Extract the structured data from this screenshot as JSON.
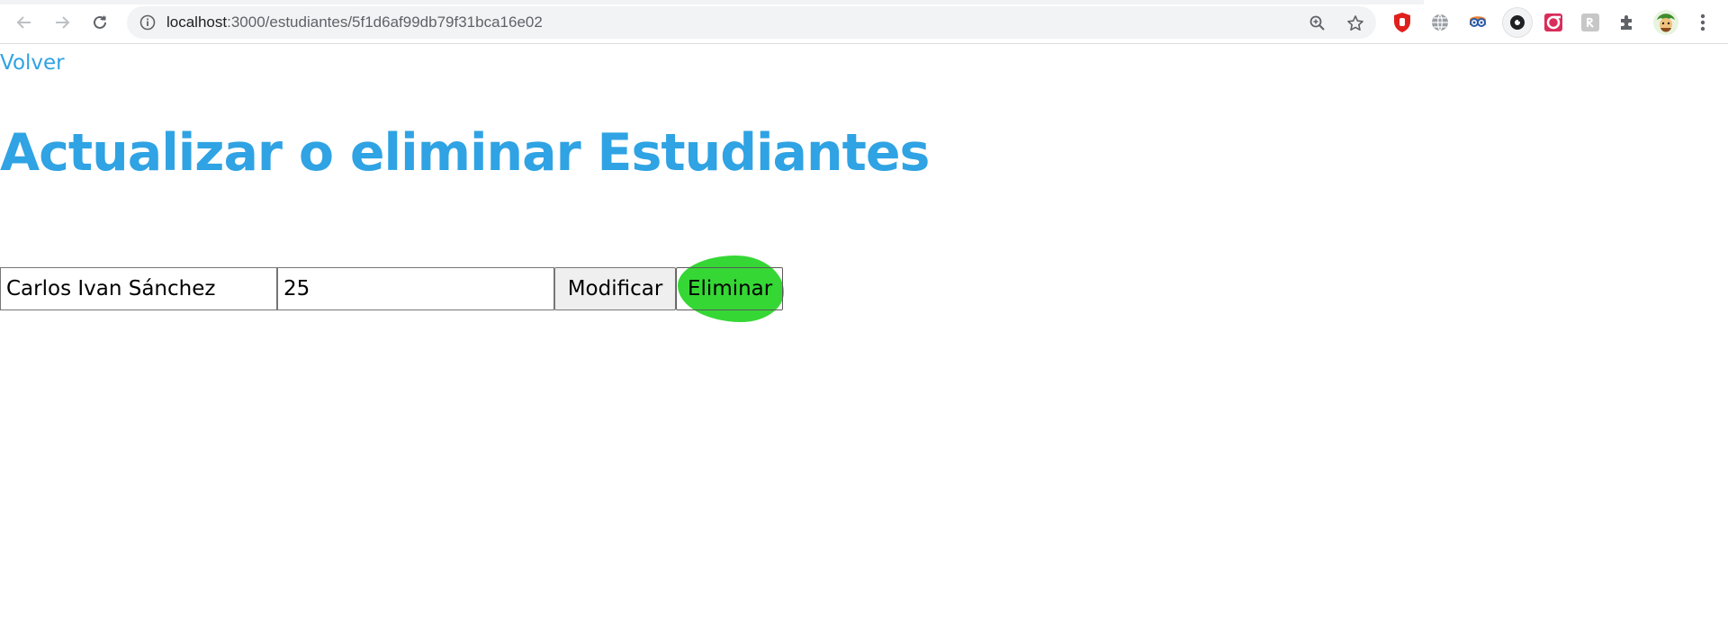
{
  "browser": {
    "url_host": "localhost",
    "url_path": ":3000/estudiantes/5f1d6af99db79f31bca16e02",
    "icons": {
      "back": "back-arrow-icon",
      "forward": "forward-arrow-icon",
      "reload": "reload-icon",
      "site_info": "info-icon",
      "zoom": "zoom-icon",
      "bookmark": "star-icon",
      "extensions": [
        "ublock-icon",
        "globe-icon",
        "goggles-icon",
        "camera-icon",
        "redirect-icon",
        "script-icon",
        "puzzle-icon",
        "avatar-icon",
        "menu-dots-icon"
      ]
    }
  },
  "page": {
    "back_link": "Volver",
    "title": "Actualizar o eliminar Estudiantes",
    "form": {
      "name_value": "Carlos Ivan Sánchez",
      "age_value": "25",
      "modify_label": "Modificar",
      "delete_label": "Eliminar"
    }
  },
  "colors": {
    "accent": "#2fa3e3",
    "highlight": "#2ed62e"
  }
}
